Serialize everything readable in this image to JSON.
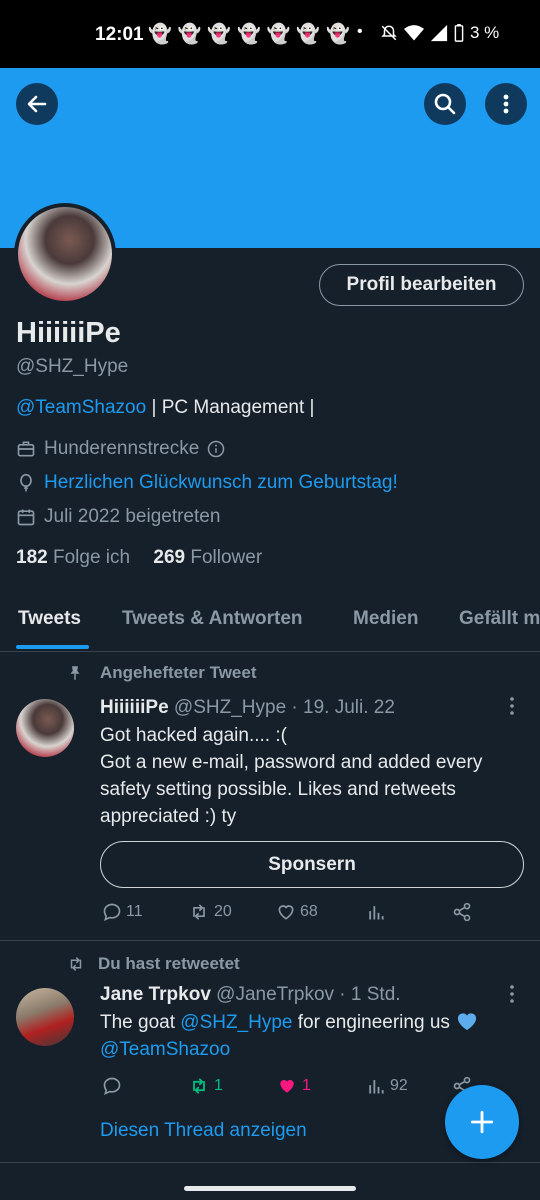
{
  "status": {
    "time": "12:01",
    "snap_icons": [
      "snapchat-icon",
      "snapchat-icon",
      "snapchat-icon",
      "snapchat-icon",
      "snapchat-icon",
      "snapchat-icon",
      "snapchat-icon"
    ],
    "battery": "3 %"
  },
  "header": {
    "back_icon": "back-arrow-icon",
    "search_icon": "search-icon",
    "more_icon": "more-vertical-icon",
    "banner_color": "#1d9bf0"
  },
  "profile": {
    "edit_label": "Profil bearbeiten",
    "name": "HiiiiiiPe",
    "handle": "@SHZ_Hype",
    "bio_link": "@TeamShazoo",
    "bio_rest": " | PC Management |",
    "job": "Hunderennstrecke",
    "birthday": "Herzlichen Glückwunsch zum Geburtstag!",
    "joined": "Juli 2022 beigetreten",
    "following_count": "182",
    "following_label": "Folge ich",
    "followers_count": "269",
    "followers_label": "Follower"
  },
  "tabs": [
    "Tweets",
    "Tweets & Antworten",
    "Medien",
    "Gefällt mir"
  ],
  "pinned": {
    "label": "Angehefteter Tweet",
    "name": "HiiiiiiPe",
    "handle_date": "@SHZ_Hype · 19. Juli. 22",
    "line1": "Got hacked again.... :(",
    "line2": "Got a new e-mail, password and added every safety setting possible. Likes and retweets appreciated :) ty",
    "sponsor_label": "Sponsern",
    "replies": "11",
    "retweets": "20",
    "likes": "68"
  },
  "retweet": {
    "label": "Du hast retweetet",
    "name": "Jane Trpkov",
    "handle_date": "@JaneTrpkov · 1 Std.",
    "text_a": "The goat ",
    "text_mention": "@SHZ_Hype",
    "text_b": " for engineering us ",
    "text_mention2": "@TeamShazoo",
    "retweets": "1",
    "likes": "1",
    "views": "92",
    "show_thread": "Diesen Thread anzeigen"
  },
  "fab_icon": "compose-plus-icon"
}
